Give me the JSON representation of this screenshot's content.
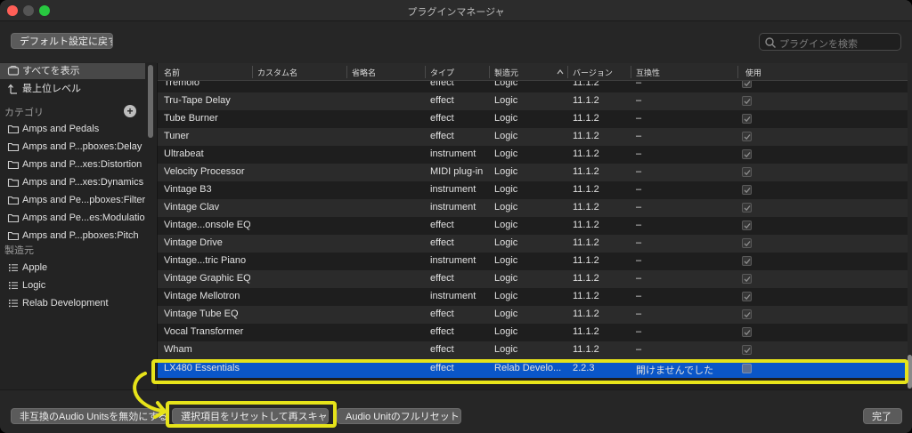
{
  "window": {
    "title": "プラグインマネージャ"
  },
  "toolbar": {
    "default_button": "デフォルト設定に戻す",
    "search_placeholder": "プラグインを検索"
  },
  "sidebar": {
    "top_items": [
      {
        "label": "すべてを表示",
        "icon": "all-plugins-icon",
        "selected": true
      },
      {
        "label": "最上位レベル",
        "icon": "top-level-arrow-icon",
        "selected": false
      }
    ],
    "category_header": "カテゴリ",
    "categories": [
      "Amps and Pedals",
      "Amps and P...pboxes:Delay",
      "Amps and P...xes:Distortion",
      "Amps and P...xes:Dynamics",
      "Amps and Pe...pboxes:Filter",
      "Amps and Pe...es:Modulation",
      "Amps and P...pboxes:Pitch"
    ],
    "manufacturer_header": "製造元",
    "manufacturers": [
      "Apple",
      "Logic",
      "Relab Development"
    ]
  },
  "table": {
    "columns": [
      "名前",
      "カスタム名",
      "省略名",
      "タイプ",
      "製造元",
      "バージョン",
      "互換性",
      "使用"
    ],
    "rows": [
      {
        "name": "Tremolo",
        "type": "effect",
        "manufacturer": "Logic",
        "version": "11.1.2",
        "compat": "–",
        "checked": true
      },
      {
        "name": "Tru-Tape Delay",
        "type": "effect",
        "manufacturer": "Logic",
        "version": "11.1.2",
        "compat": "–",
        "checked": true
      },
      {
        "name": "Tube Burner",
        "type": "effect",
        "manufacturer": "Logic",
        "version": "11.1.2",
        "compat": "–",
        "checked": true
      },
      {
        "name": "Tuner",
        "type": "effect",
        "manufacturer": "Logic",
        "version": "11.1.2",
        "compat": "–",
        "checked": true
      },
      {
        "name": "Ultrabeat",
        "type": "instrument",
        "manufacturer": "Logic",
        "version": "11.1.2",
        "compat": "–",
        "checked": true
      },
      {
        "name": "Velocity Processor",
        "type": "MIDI plug-in",
        "manufacturer": "Logic",
        "version": "11.1.2",
        "compat": "–",
        "checked": true
      },
      {
        "name": "Vintage B3",
        "type": "instrument",
        "manufacturer": "Logic",
        "version": "11.1.2",
        "compat": "–",
        "checked": true
      },
      {
        "name": "Vintage Clav",
        "type": "instrument",
        "manufacturer": "Logic",
        "version": "11.1.2",
        "compat": "–",
        "checked": true
      },
      {
        "name": "Vintage...onsole EQ",
        "type": "effect",
        "manufacturer": "Logic",
        "version": "11.1.2",
        "compat": "–",
        "checked": true
      },
      {
        "name": "Vintage Drive",
        "type": "effect",
        "manufacturer": "Logic",
        "version": "11.1.2",
        "compat": "–",
        "checked": true
      },
      {
        "name": "Vintage...tric Piano",
        "type": "instrument",
        "manufacturer": "Logic",
        "version": "11.1.2",
        "compat": "–",
        "checked": true
      },
      {
        "name": "Vintage Graphic EQ",
        "type": "effect",
        "manufacturer": "Logic",
        "version": "11.1.2",
        "compat": "–",
        "checked": true
      },
      {
        "name": "Vintage Mellotron",
        "type": "instrument",
        "manufacturer": "Logic",
        "version": "11.1.2",
        "compat": "–",
        "checked": true
      },
      {
        "name": "Vintage Tube EQ",
        "type": "effect",
        "manufacturer": "Logic",
        "version": "11.1.2",
        "compat": "–",
        "checked": true
      },
      {
        "name": "Vocal Transformer",
        "type": "effect",
        "manufacturer": "Logic",
        "version": "11.1.2",
        "compat": "–",
        "checked": true
      },
      {
        "name": "Wham",
        "type": "effect",
        "manufacturer": "Logic",
        "version": "11.1.2",
        "compat": "–",
        "checked": true
      },
      {
        "name": "LX480 Essentials",
        "type": "effect",
        "manufacturer": "Relab Develo...",
        "version": "2.2.3",
        "compat": "開けませんでした",
        "checked": false,
        "selected": true
      }
    ]
  },
  "bottom": {
    "disable_incompatible": "非互換のAudio Unitsを無効にする",
    "reset_rescan": "選択項目をリセットして再スキャン",
    "full_reset": "Audio Unitのフルリセット",
    "done": "完了"
  },
  "colors": {
    "selection": "#0a56c8",
    "annotation": "#e6e31a"
  }
}
